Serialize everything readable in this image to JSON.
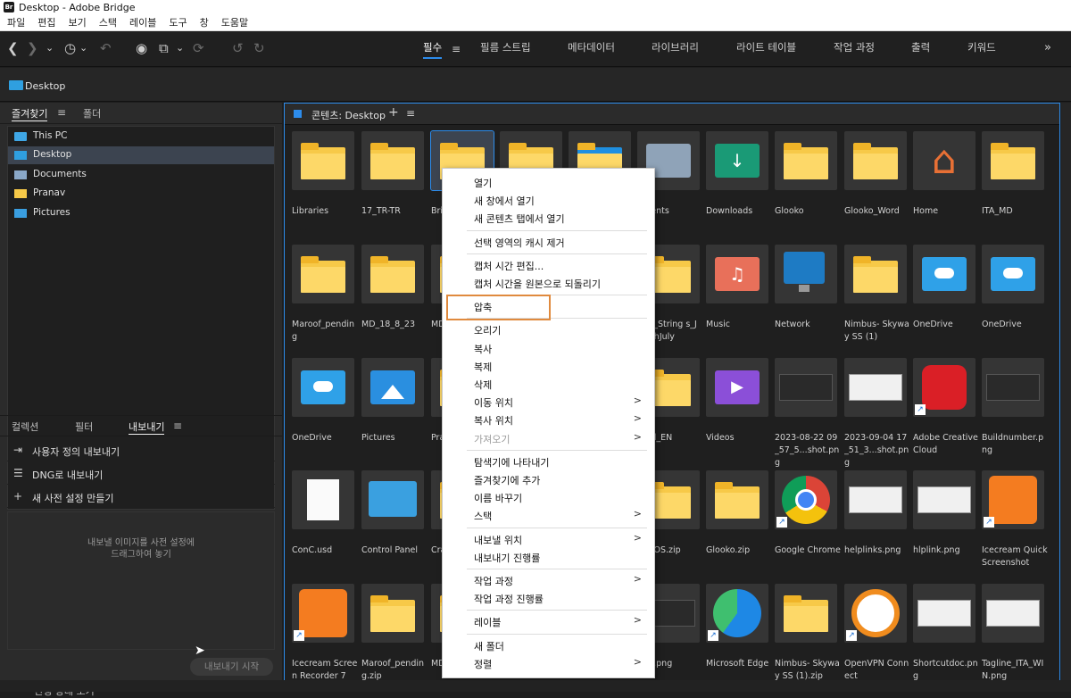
{
  "window": {
    "logo": "Br",
    "title": "Desktop - Adobe Bridge"
  },
  "menu": [
    "파일",
    "편집",
    "보기",
    "스택",
    "레이블",
    "도구",
    "창",
    "도움말"
  ],
  "toolbar": {
    "icons": [
      "chevron-left-icon",
      "chevron-right-icon",
      "chevron-down-icon",
      "recent-icon",
      "boomerang-icon",
      "camera-icon",
      "copy-icon",
      "refresh-icon",
      "rotate-left-icon",
      "rotate-right-icon"
    ]
  },
  "workspaces": [
    {
      "label": "필수",
      "active": true
    },
    {
      "label": "필름 스트립"
    },
    {
      "label": "메타데이터"
    },
    {
      "label": "라이브러리"
    },
    {
      "label": "라이트 테이블"
    },
    {
      "label": "작업 과정"
    },
    {
      "label": "출력"
    },
    {
      "label": "키워드"
    }
  ],
  "path": {
    "label": "Desktop"
  },
  "leftTabs": {
    "favorites": "즐겨찾기",
    "folders": "폴더"
  },
  "favorites": [
    {
      "label": "This PC",
      "icon": "monitor-icon"
    },
    {
      "label": "Desktop",
      "icon": "desktop-icon",
      "selected": true
    },
    {
      "label": "Documents",
      "icon": "documents-icon"
    },
    {
      "label": "Pranav",
      "icon": "folder-icon"
    },
    {
      "label": "Pictures",
      "icon": "pictures-icon"
    }
  ],
  "bottomTabs": {
    "collections": "컬렉션",
    "filter": "필터",
    "export": "내보내기"
  },
  "exportItems": [
    {
      "label": "사용자 정의 내보내기",
      "icon": "export-icon"
    },
    {
      "label": "DNG로 내보내기",
      "icon": "list-icon"
    },
    {
      "label": "새 사전 설정 만들기",
      "icon": "plus-icon"
    }
  ],
  "dropHint": {
    "line1": "내보낼 이미지를 사전 설정에",
    "line2": "드래그하여 놓기"
  },
  "exportStart": "내보내기 시작",
  "bottomPartial": "진행 상태 보기",
  "content": {
    "title": "콘텐츠: Desktop"
  },
  "items": [
    "Libraries",
    "17_TR-TR",
    "Bri",
    "",
    "",
    "uments",
    "Downloads",
    "Glooko",
    "Glooko_Word",
    "Home",
    "ITA_MD",
    "Maroof_pending",
    "MD_18_8_23",
    "MD",
    "",
    "",
    "eler_String s_Ju...thJuly",
    "Music",
    "Network",
    "Nimbus- Skyway SS (1)",
    "OneDrive",
    "OneDrive",
    "OneDrive",
    "Pictures",
    "Pra",
    "",
    "",
    "ated_EN",
    "Videos",
    "2023-08-22 09_57_5...shot.png",
    "2023-09-04 17_51_3...shot.png",
    "Adobe Creative Cloud",
    "Buildnumber.png",
    "ConC.usd",
    "Control Panel",
    "Cra .pn",
    "",
    "",
    "ko_IOS.zip",
    "Glooko.zip",
    "Google Chrome",
    "helplinks.png",
    "hlplink.png",
    "Icecream Quick Screenshot",
    "Icecream Screen Recorder 7",
    "Maroof_pending.zip",
    "MD",
    "",
    "",
    "480.png",
    "Microsoft Edge",
    "Nimbus- Skyway SS (1).zip",
    "OpenVPN Connect",
    "Shortcutdoc.png",
    "Tagline_ITA_WIN.png"
  ],
  "contextMenu": [
    {
      "label": "열기"
    },
    {
      "label": "새 창에서 열기"
    },
    {
      "label": "새 콘텐츠 탭에서 열기"
    },
    {
      "sep": true
    },
    {
      "label": "선택 영역의 캐시 제거"
    },
    {
      "sep": true
    },
    {
      "label": "캡처 시간 편집..."
    },
    {
      "label": "캡처 시간을 원본으로 되돌리기"
    },
    {
      "sep": true
    },
    {
      "label": "압축"
    },
    {
      "sep": true
    },
    {
      "label": "오리기"
    },
    {
      "label": "복사"
    },
    {
      "label": "복제"
    },
    {
      "label": "삭제"
    },
    {
      "label": "이동 위치",
      "arrow": ">"
    },
    {
      "label": "복사 위치",
      "arrow": ">"
    },
    {
      "label": "가져오기",
      "arrow": ">",
      "disabled": true
    },
    {
      "sep": true
    },
    {
      "label": "탐색기에 나타내기"
    },
    {
      "label": "즐겨찾기에 추가"
    },
    {
      "label": "이름 바꾸기"
    },
    {
      "label": "스택",
      "arrow": ">"
    },
    {
      "sep": true
    },
    {
      "label": "내보낼 위치",
      "arrow": ">"
    },
    {
      "label": "내보내기 진행률"
    },
    {
      "sep": true
    },
    {
      "label": "작업 과정",
      "arrow": ">"
    },
    {
      "label": "작업 과정 진행률"
    },
    {
      "sep": true
    },
    {
      "label": "레이블",
      "arrow": ">"
    },
    {
      "sep": true
    },
    {
      "label": "새 폴더"
    },
    {
      "label": "정렬",
      "arrow": ">"
    }
  ],
  "colors": {
    "accent": "#2d8ceb",
    "folder": "#f7c948",
    "highlight": "#e08a3e"
  }
}
